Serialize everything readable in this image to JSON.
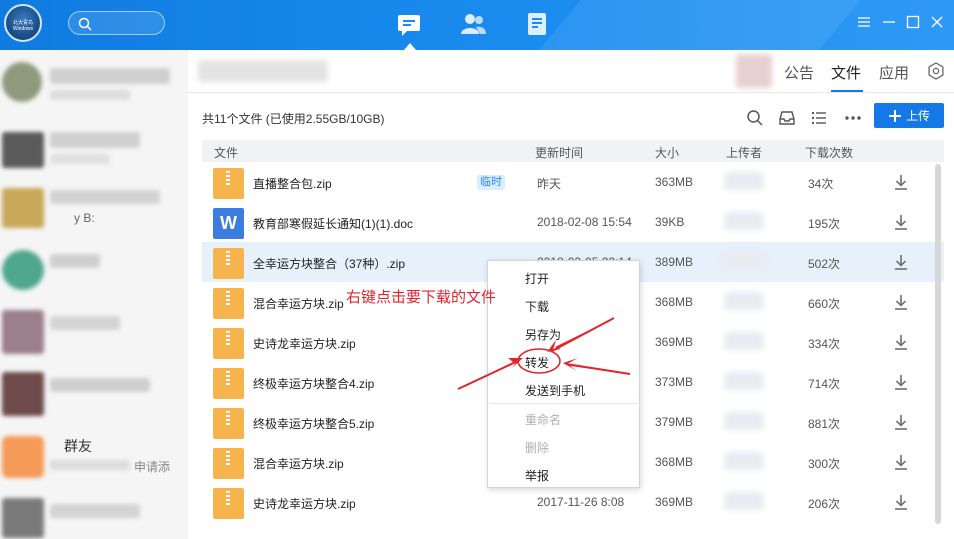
{
  "topbar": {
    "avatar_text": "北大青鸟 Windows",
    "icons": [
      "chat-icon",
      "contacts-icon",
      "notes-icon"
    ],
    "window_controls": [
      "menu-icon",
      "minimize-icon",
      "maximize-icon",
      "close-icon"
    ]
  },
  "sidebar": {
    "visible_texts": [
      "y B:",
      "群友",
      "申请添"
    ]
  },
  "main": {
    "tabs": [
      {
        "label": "公告",
        "active": false
      },
      {
        "label": "文件",
        "active": true
      },
      {
        "label": "应用",
        "active": false
      }
    ],
    "file_count": "共11个文件 (已使用2.55GB/10GB)",
    "upload_label": "上传",
    "columns": {
      "name": "文件",
      "updated": "更新时间",
      "size": "大小",
      "uploader": "上传者",
      "downloads": "下载次数"
    },
    "files": [
      {
        "name": "直播整合包.zip",
        "type": "zip",
        "badge": "临时",
        "updated": "昨天",
        "size": "363MB",
        "downloads": "34次"
      },
      {
        "name": "教育部寒假延长通知(1)(1).doc",
        "type": "doc",
        "icon_letter": "W",
        "updated": "2018-02-08 15:54",
        "size": "39KB",
        "downloads": "195次"
      },
      {
        "name": "全幸运方块整合（37种）.zip",
        "type": "zip",
        "updated": "2018-02-05 22:14",
        "size": "389MB",
        "downloads": "502次",
        "selected": true
      },
      {
        "name": "混合幸运方块.zip",
        "type": "zip",
        "updated": "",
        "size": "368MB",
        "downloads": "660次"
      },
      {
        "name": "史诗龙幸运方块.zip",
        "type": "zip",
        "updated": "",
        "size": "369MB",
        "downloads": "334次"
      },
      {
        "name": "终极幸运方块整合4.zip",
        "type": "zip",
        "updated": "",
        "size": "373MB",
        "downloads": "714次"
      },
      {
        "name": "终极幸运方块整合5.zip",
        "type": "zip",
        "updated": "",
        "size": "379MB",
        "downloads": "881次"
      },
      {
        "name": "混合幸运方块.zip",
        "type": "zip",
        "updated": "",
        "size": "368MB",
        "downloads": "300次"
      },
      {
        "name": "史诗龙幸运方块.zip",
        "type": "zip",
        "updated": "2017-11-26 8:08",
        "size": "369MB",
        "downloads": "206次"
      }
    ]
  },
  "context_menu": {
    "items": [
      {
        "label": "打开",
        "enabled": true
      },
      {
        "label": "下载",
        "enabled": true
      },
      {
        "label": "另存为",
        "enabled": true
      },
      {
        "label": "转发",
        "enabled": true,
        "highlighted": true
      },
      {
        "label": "发送到手机",
        "enabled": true
      },
      {
        "label": "重命名",
        "enabled": false
      },
      {
        "label": "删除",
        "enabled": false
      },
      {
        "label": "举报",
        "enabled": true
      }
    ]
  },
  "annotation": {
    "text": "右键点击要下载的文件",
    "color": "#e0262d"
  },
  "colors": {
    "accent": "#1677e6",
    "topbar": "#0f7be0",
    "zip_icon": "#f6b44c",
    "doc_icon": "#3c7be0",
    "selected_row": "#e6f1fc"
  }
}
